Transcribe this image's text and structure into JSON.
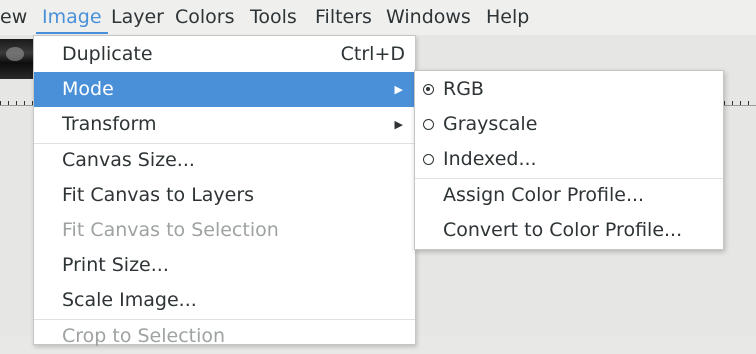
{
  "menubar": {
    "items": [
      {
        "label": "ew"
      },
      {
        "label": "Image"
      },
      {
        "label": "Layer"
      },
      {
        "label": "Colors"
      },
      {
        "label": "Tools"
      },
      {
        "label": "Filters"
      },
      {
        "label": "Windows"
      },
      {
        "label": "Help"
      }
    ]
  },
  "image_menu": {
    "duplicate": {
      "label": "Duplicate",
      "shortcut": "Ctrl+D"
    },
    "mode": {
      "label": "Mode"
    },
    "transform": {
      "label": "Transform"
    },
    "canvas_size": {
      "label": "Canvas Size..."
    },
    "fit_canvas_layers": {
      "label": "Fit Canvas to Layers"
    },
    "fit_canvas_selection": {
      "label": "Fit Canvas to Selection"
    },
    "print_size": {
      "label": "Print Size..."
    },
    "scale_image": {
      "label": "Scale Image..."
    },
    "crop_selection": {
      "label": "Crop to Selection"
    }
  },
  "mode_submenu": {
    "rgb": {
      "label": "RGB",
      "checked": true
    },
    "grayscale": {
      "label": "Grayscale",
      "checked": false
    },
    "indexed": {
      "label": "Indexed...",
      "checked": false
    },
    "assign_profile": {
      "label": "Assign Color Profile..."
    },
    "convert_profile": {
      "label": "Convert to Color Profile..."
    }
  },
  "colors": {
    "accent": "#4a90d9",
    "text": "#2e3436",
    "disabled": "#9ea2a2"
  }
}
